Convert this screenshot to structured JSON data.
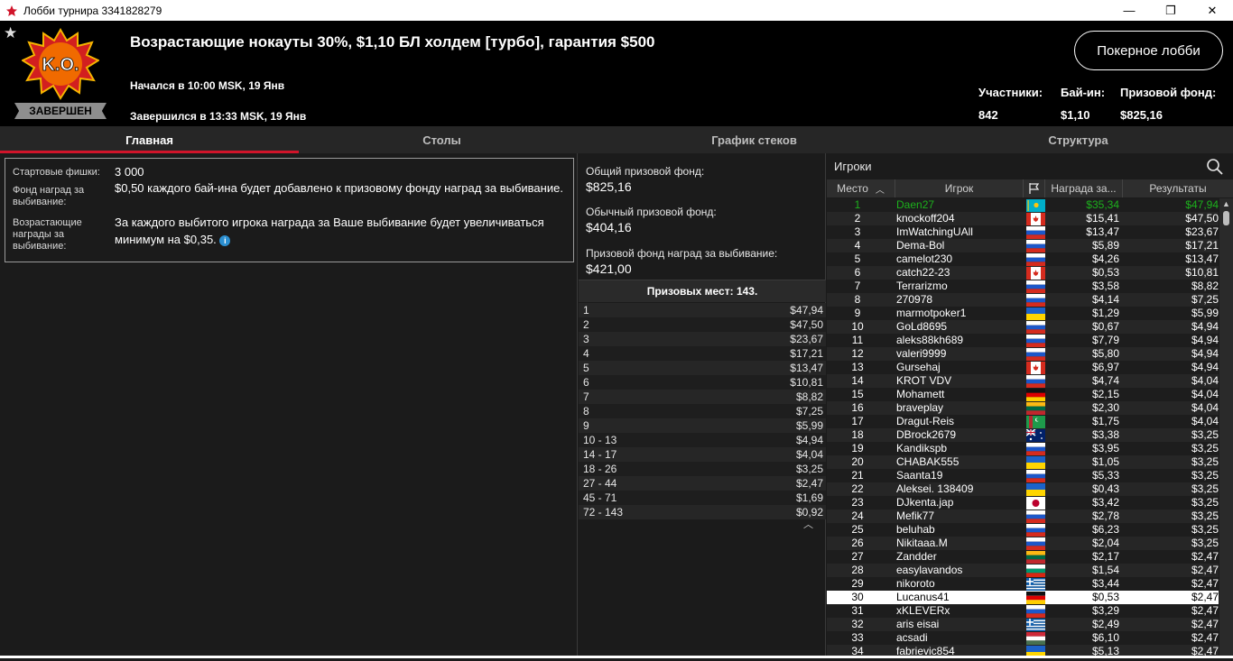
{
  "window": {
    "title": "Лобби турнира 3341828279",
    "minimize": "—",
    "restore": "❐",
    "close": "✕"
  },
  "header": {
    "logo_text": "K.O.",
    "status": "ЗАВЕРШЕН",
    "title": "Возрастающие нокауты 30%, $1,10 БЛ холдем [турбо], гарантия $500",
    "started": "Начался в 10:00 MSK, 19 Янв",
    "ended": "Завершился в 13:33 MSK, 19 Янв",
    "lobby_button": "Покерное лобби",
    "entrants_label": "Участники:",
    "entrants_value": "842",
    "buyin_label": "Бай-ин:",
    "buyin_value": "$1,10",
    "prizepool_label": "Призовой фонд:",
    "prizepool_value": "$825,16"
  },
  "tabs": [
    "Главная",
    "Столы",
    "График стеков",
    "Структура"
  ],
  "info": {
    "chips_label": "Стартовые фишки:",
    "chips_value": "3 000",
    "bounty_fund_label": "Фонд наград за выбивание:",
    "bounty_fund_value": "$0,50 каждого бай-ина будет добавлено к призовому фонду наград за выбивание.",
    "progressive_label": "Возрастающие награды за выбивание:",
    "progressive_value": "За каждого выбитого игрока награда за Ваше выбивание будет увеличиваться минимум на $0,35."
  },
  "pools": {
    "total_label": "Общий призовой фонд:",
    "total_value": "$825,16",
    "regular_label": "Обычный призовой фонд:",
    "regular_value": "$404,16",
    "bounty_label": "Призовой фонд наград за выбивание:",
    "bounty_value": "$421,00",
    "places_title": "Призовых мест: 143."
  },
  "prizes": [
    {
      "place": "1",
      "amount": "$47,94"
    },
    {
      "place": "2",
      "amount": "$47,50"
    },
    {
      "place": "3",
      "amount": "$23,67"
    },
    {
      "place": "4",
      "amount": "$17,21"
    },
    {
      "place": "5",
      "amount": "$13,47"
    },
    {
      "place": "6",
      "amount": "$10,81"
    },
    {
      "place": "7",
      "amount": "$8,82"
    },
    {
      "place": "8",
      "amount": "$7,25"
    },
    {
      "place": "9",
      "amount": "$5,99"
    },
    {
      "place": "10 - 13",
      "amount": "$4,94"
    },
    {
      "place": "14 - 17",
      "amount": "$4,04"
    },
    {
      "place": "18 - 26",
      "amount": "$3,25"
    },
    {
      "place": "27 - 44",
      "amount": "$2,47"
    },
    {
      "place": "45 - 71",
      "amount": "$1,69"
    },
    {
      "place": "72 - 143",
      "amount": "$0,92"
    }
  ],
  "players_panel": {
    "title": "Игроки",
    "col_place": "Место",
    "col_player": "Игрок",
    "col_bounty": "Награда за...",
    "col_result": "Результаты"
  },
  "players": [
    {
      "place": "1",
      "name": "Daen27",
      "flag": "kz",
      "bounty": "$35,34",
      "result": "$47,94"
    },
    {
      "place": "2",
      "name": "knockoff204",
      "flag": "ca",
      "bounty": "$15,41",
      "result": "$47,50"
    },
    {
      "place": "3",
      "name": "ImWatchingUAll",
      "flag": "ru",
      "bounty": "$13,47",
      "result": "$23,67"
    },
    {
      "place": "4",
      "name": "Dema-Bol",
      "flag": "ru",
      "bounty": "$5,89",
      "result": "$17,21"
    },
    {
      "place": "5",
      "name": "camelot230",
      "flag": "ru",
      "bounty": "$4,26",
      "result": "$13,47"
    },
    {
      "place": "6",
      "name": "catch22-23",
      "flag": "ca",
      "bounty": "$0,53",
      "result": "$10,81"
    },
    {
      "place": "7",
      "name": "Terrarizmo",
      "flag": "ru",
      "bounty": "$3,58",
      "result": "$8,82"
    },
    {
      "place": "8",
      "name": "270978",
      "flag": "ru",
      "bounty": "$4,14",
      "result": "$7,25"
    },
    {
      "place": "9",
      "name": "marmotpoker1",
      "flag": "ua",
      "bounty": "$1,29",
      "result": "$5,99"
    },
    {
      "place": "10",
      "name": "GoLd8695",
      "flag": "ru",
      "bounty": "$0,67",
      "result": "$4,94"
    },
    {
      "place": "11",
      "name": "aleks88kh689",
      "flag": "ru",
      "bounty": "$7,79",
      "result": "$4,94"
    },
    {
      "place": "12",
      "name": "valeri9999",
      "flag": "ru",
      "bounty": "$5,80",
      "result": "$4,94"
    },
    {
      "place": "13",
      "name": "Gursehaj",
      "flag": "ca",
      "bounty": "$6,97",
      "result": "$4,94"
    },
    {
      "place": "14",
      "name": "KROT VDV",
      "flag": "ru",
      "bounty": "$4,74",
      "result": "$4,04"
    },
    {
      "place": "15",
      "name": "Mohamett",
      "flag": "de",
      "bounty": "$2,15",
      "result": "$4,04"
    },
    {
      "place": "16",
      "name": "braveplay",
      "flag": "lt",
      "bounty": "$2,30",
      "result": "$4,04"
    },
    {
      "place": "17",
      "name": "Dragut-Reis",
      "flag": "tm",
      "bounty": "$1,75",
      "result": "$4,04"
    },
    {
      "place": "18",
      "name": "DBrock2679",
      "flag": "au",
      "bounty": "$3,38",
      "result": "$3,25"
    },
    {
      "place": "19",
      "name": "Kandikspb",
      "flag": "ru",
      "bounty": "$3,95",
      "result": "$3,25"
    },
    {
      "place": "20",
      "name": "CHABAK555",
      "flag": "ua",
      "bounty": "$1,05",
      "result": "$3,25"
    },
    {
      "place": "21",
      "name": "Saanta19",
      "flag": "ru",
      "bounty": "$5,33",
      "result": "$3,25"
    },
    {
      "place": "22",
      "name": "Aleksei. 138409",
      "flag": "ua",
      "bounty": "$0,43",
      "result": "$3,25"
    },
    {
      "place": "23",
      "name": "DJkenta.jap",
      "flag": "jp",
      "bounty": "$3,42",
      "result": "$3,25"
    },
    {
      "place": "24",
      "name": "Mefik77",
      "flag": "ru",
      "bounty": "$2,78",
      "result": "$3,25"
    },
    {
      "place": "25",
      "name": "beluhab",
      "flag": "ru",
      "bounty": "$6,23",
      "result": "$3,25"
    },
    {
      "place": "26",
      "name": "Nikitaaa.M",
      "flag": "ru",
      "bounty": "$2,04",
      "result": "$3,25"
    },
    {
      "place": "27",
      "name": "Zandder",
      "flag": "lt",
      "bounty": "$2,17",
      "result": "$2,47"
    },
    {
      "place": "28",
      "name": "easylavandos",
      "flag": "bg",
      "bounty": "$1,54",
      "result": "$2,47"
    },
    {
      "place": "29",
      "name": "nikoroto",
      "flag": "gr",
      "bounty": "$3,44",
      "result": "$2,47"
    },
    {
      "place": "30",
      "name": "Lucanus41",
      "flag": "de",
      "bounty": "$0,53",
      "result": "$2,47"
    },
    {
      "place": "31",
      "name": "xKLEVERx",
      "flag": "ru",
      "bounty": "$3,29",
      "result": "$2,47"
    },
    {
      "place": "32",
      "name": "aris eisai",
      "flag": "gr",
      "bounty": "$2,49",
      "result": "$2,47"
    },
    {
      "place": "33",
      "name": "acsadi",
      "flag": "hu",
      "bounty": "$6,10",
      "result": "$2,47"
    },
    {
      "place": "34",
      "name": "fabrievic854",
      "flag": "ua",
      "bounty": "$5,13",
      "result": "$2,47"
    }
  ],
  "highlight_place": "30",
  "colors": {
    "accent_red": "#d1142a",
    "winner_green": "#1db11d",
    "background": "#1b1b1b",
    "header_bg": "#000000"
  }
}
